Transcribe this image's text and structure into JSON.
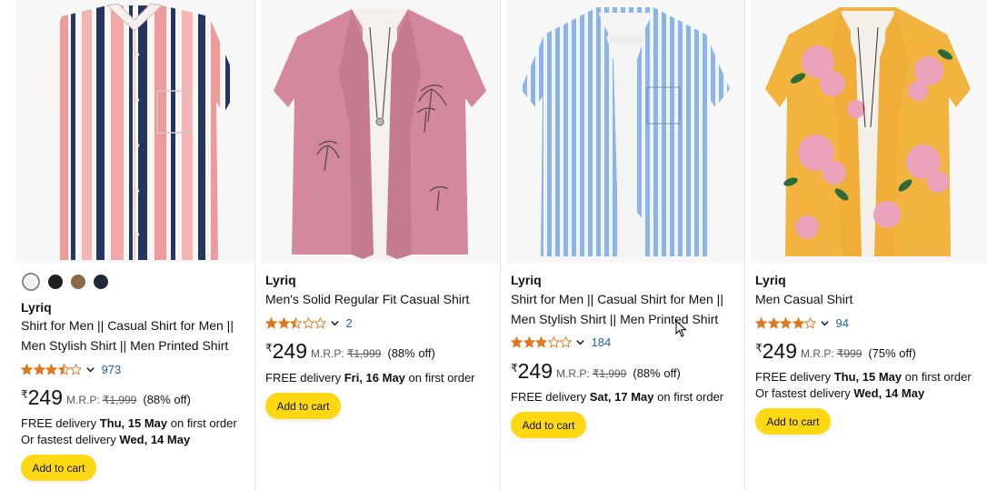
{
  "products": [
    {
      "brand": "Lyriq",
      "title_lines": [
        "Shirt for Men || Casual Shirt for Men ||",
        "Men Stylish Shirt || Men Printed Shirt"
      ],
      "rating": 3.5,
      "rating_count": "973",
      "currency": "₹",
      "price": "249",
      "mrp_label": "M.R.P:",
      "mrp": "₹1,999",
      "discount": "(88% off)",
      "delivery_prefix": "FREE delivery",
      "delivery_date": "Thu, 15 May",
      "delivery_suffix": "on first order",
      "fastest_prefix": "Or fastest delivery",
      "fastest_date": "Wed, 14 May",
      "cart_label": "Add to cart",
      "swatches": [
        "#f4f1ec",
        "#1f1f1f",
        "#8a6a45",
        "#1e2a38"
      ]
    },
    {
      "brand": "Lyriq",
      "title_lines": [
        "Men's Solid Regular Fit Casual Shirt"
      ],
      "rating": 2.5,
      "rating_count": "2",
      "currency": "₹",
      "price": "249",
      "mrp_label": "M.R.P:",
      "mrp": "₹1,999",
      "discount": "(88% off)",
      "delivery_prefix": "FREE delivery",
      "delivery_date": "Fri, 16 May",
      "delivery_suffix": "on first order",
      "cart_label": "Add to cart"
    },
    {
      "brand": "Lyriq",
      "title_lines": [
        "Shirt for Men || Casual Shirt for Men ||",
        "Men Stylish Shirt || Men Printed Shirt"
      ],
      "rating": 3.0,
      "rating_count": "184",
      "currency": "₹",
      "price": "249",
      "mrp_label": "M.R.P:",
      "mrp": "₹1,999",
      "discount": "(88% off)",
      "delivery_prefix": "FREE delivery",
      "delivery_date": "Sat, 17 May",
      "delivery_suffix": "on first order",
      "cart_label": "Add to cart"
    },
    {
      "brand": "Lyriq",
      "title_lines": [
        "Men Casual Shirt"
      ],
      "rating": 4.0,
      "rating_count": "94",
      "currency": "₹",
      "price": "249",
      "mrp_label": "M.R.P:",
      "mrp": "₹999",
      "discount": "(75% off)",
      "delivery_prefix": "FREE delivery",
      "delivery_date": "Thu, 15 May",
      "delivery_suffix": "on first order",
      "fastest_prefix": "Or fastest delivery",
      "fastest_date": "Wed, 14 May",
      "cart_label": "Add to cart"
    }
  ],
  "colors": {
    "star": "#de7921",
    "link": "#2162a1",
    "cart_button": "#ffd814"
  }
}
